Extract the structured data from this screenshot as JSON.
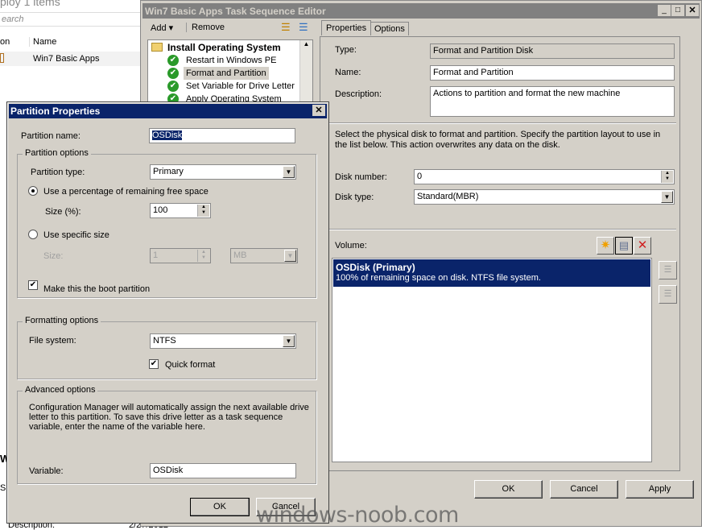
{
  "background": {
    "header": "ploy 1 items",
    "search_placeholder": "earch",
    "col_icon": "on",
    "col_name": "Name",
    "row_name": "Win7 Basic Apps",
    "side_w": "W",
    "side_s": "Su",
    "desc_label": "Description:",
    "desc_value": "2/27/2012"
  },
  "editor": {
    "title": "Win7 Basic Apps Task Sequence Editor",
    "add": "Add",
    "remove": "Remove",
    "tree": {
      "group": "Install Operating System",
      "items": [
        "Restart in Windows PE",
        "Format and Partition",
        "Set Variable for Drive Letter",
        "Apply Operating System"
      ]
    },
    "tabs": [
      "Properties",
      "Options"
    ],
    "type_label": "Type:",
    "type_value": "Format and Partition Disk",
    "name_label": "Name:",
    "name_value": "Format and Partition",
    "desc_label": "Description:",
    "desc_value": "Actions to partition and format the new machine",
    "info": "Select the physical disk to format and partition. Specify the partition layout to use in the list below. This action overwrites any data on the disk.",
    "disk_number_label": "Disk number:",
    "disk_number": "0",
    "disk_type_label": "Disk type:",
    "disk_type": "Standard(MBR)",
    "volume_label": "Volume:",
    "volume": {
      "title": "OSDisk (Primary)",
      "detail": "100% of remaining space on disk. NTFS file system."
    },
    "ok": "OK",
    "cancel": "Cancel",
    "apply": "Apply"
  },
  "dialog": {
    "title": "Partition Properties",
    "name_label": "Partition name:",
    "name_value": "OSDisk",
    "options_group": "Partition options",
    "type_label": "Partition type:",
    "type_value": "Primary",
    "pct_radio": "Use a percentage of remaining free space",
    "size_pct_label": "Size (%):",
    "size_pct": "100",
    "specific_radio": "Use specific size",
    "size_label": "Size:",
    "size_value": "1",
    "size_unit": "MB",
    "boot_check": "Make this the boot partition",
    "format_group": "Formatting options",
    "fs_label": "File system:",
    "fs_value": "NTFS",
    "quick_format": "Quick format",
    "adv_group": "Advanced options",
    "adv_text": "Configuration Manager will automatically assign the next available drive letter to this partition. To save this drive letter as a task sequence variable, enter the name of the variable here.",
    "variable_label": "Variable:",
    "variable_value": "OSDisk",
    "ok": "OK",
    "cancel": "Cancel"
  },
  "watermark": "windows-noob.com",
  "colors": {
    "title_active": "#0a246a",
    "title_inactive": "#808080",
    "face": "#d4d0c8",
    "selection": "#0a246a"
  }
}
